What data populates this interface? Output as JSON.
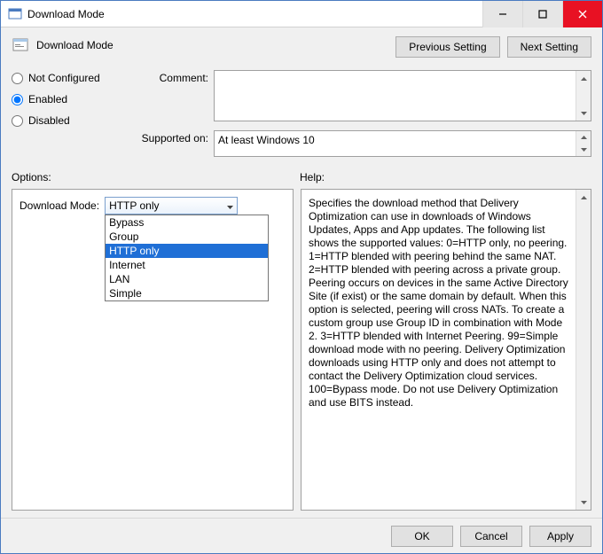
{
  "window": {
    "title": "Download Mode"
  },
  "header": {
    "setting_name": "Download Mode",
    "prev_btn": "Previous Setting",
    "next_btn": "Next Setting"
  },
  "radios": {
    "not_configured": "Not Configured",
    "enabled": "Enabled",
    "disabled": "Disabled",
    "selected": "enabled"
  },
  "fields": {
    "comment_label": "Comment:",
    "comment_value": "",
    "supported_label": "Supported on:",
    "supported_value": "At least Windows 10"
  },
  "panel_labels": {
    "options": "Options:",
    "help": "Help:"
  },
  "options": {
    "dropdown_label": "Download Mode:",
    "selected": "HTTP only",
    "items": [
      "Bypass",
      "Group",
      "HTTP only",
      "Internet",
      "LAN",
      "Simple"
    ]
  },
  "help_text": "Specifies the download method that Delivery Optimization can use in downloads of Windows Updates, Apps and App updates. The following list shows the supported values: 0=HTTP only, no peering. 1=HTTP blended with peering behind the same NAT. 2=HTTP blended with peering across a private group. Peering occurs on devices in the same Active Directory Site (if exist) or the same domain by default. When this option is selected, peering will cross NATs. To create a custom group use Group ID in combination with Mode 2. 3=HTTP blended with Internet Peering. 99=Simple download mode with no peering. Delivery Optimization downloads using HTTP only and does not attempt to contact the Delivery Optimization cloud services. 100=Bypass mode. Do not use Delivery Optimization and use BITS instead.",
  "footer": {
    "ok": "OK",
    "cancel": "Cancel",
    "apply": "Apply"
  }
}
